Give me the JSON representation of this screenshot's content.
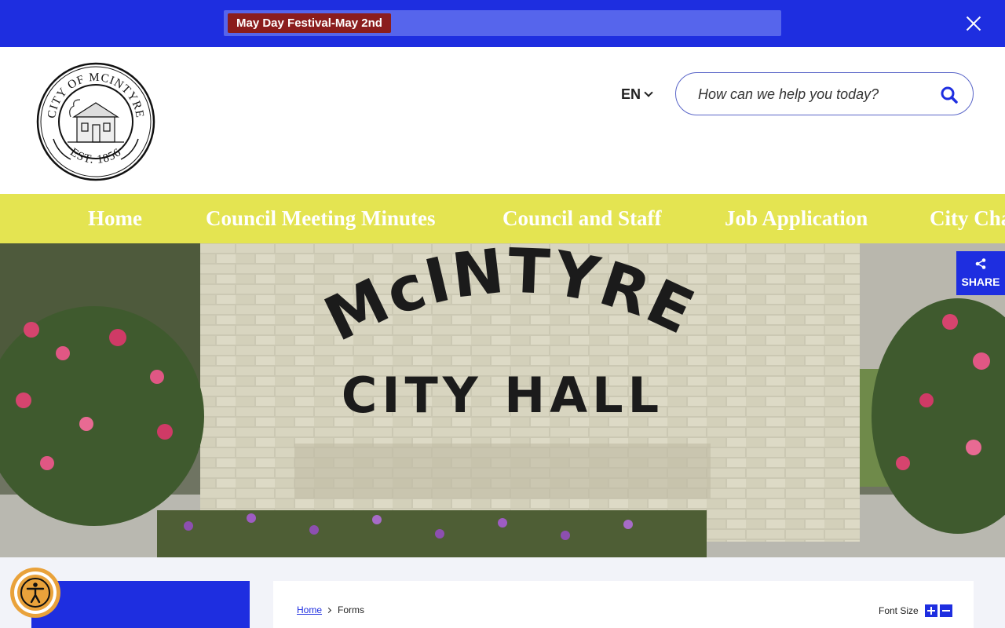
{
  "alert": {
    "text": "May Day Festival-May 2nd",
    "close_label": "Close"
  },
  "header": {
    "logo_text_top": "CITY OF MCINTYRE",
    "logo_text_bottom": "EST. 1856",
    "language": "EN",
    "search_placeholder": "How can we help you today?"
  },
  "nav": {
    "items": [
      {
        "label": "Home"
      },
      {
        "label": "Council Meeting Minutes"
      },
      {
        "label": "Council and Staff"
      },
      {
        "label": "Job Application"
      },
      {
        "label": "City Cha"
      }
    ]
  },
  "hero": {
    "sign_line1": "McINTYRE",
    "sign_line2": "CITY HALL",
    "share_label": "SHARE"
  },
  "content": {
    "breadcrumb": [
      {
        "label": "Home"
      },
      {
        "label": "Forms"
      }
    ],
    "font_size_label": "Font Size"
  },
  "colors": {
    "primary_blue": "#1e2ee0",
    "nav_yellow": "#e4e451",
    "alert_pill": "#8b1d1d",
    "a11y_orange": "#e9a23b"
  }
}
